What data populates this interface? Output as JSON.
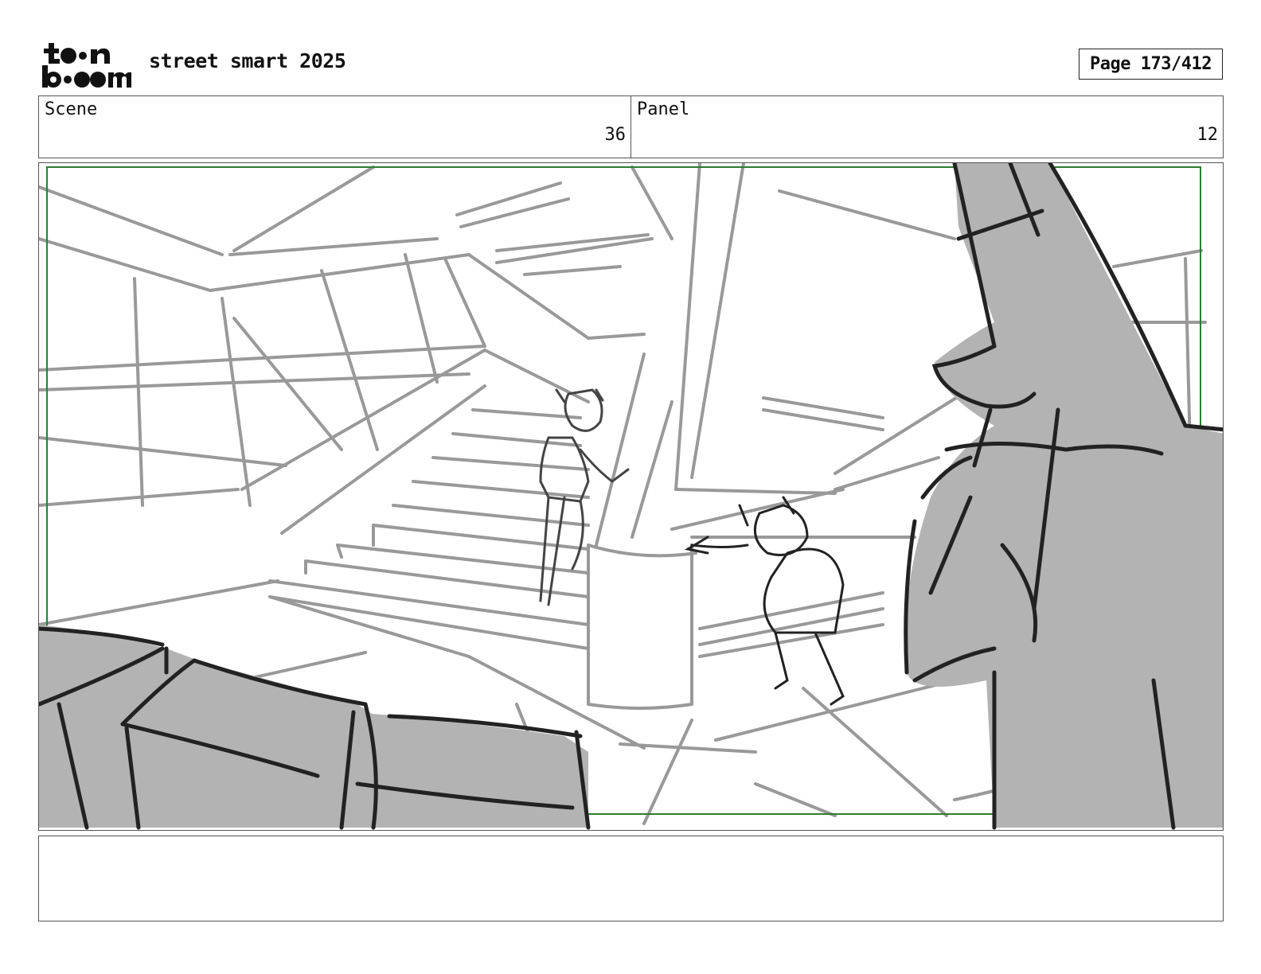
{
  "header": {
    "logo_line1": "toon",
    "logo_line2": "boom",
    "title": "street smart 2025",
    "page_indicator": "Page 173/412"
  },
  "info": {
    "scene_label": "Scene",
    "scene_value": "36",
    "panel_label": "Panel",
    "panel_value": "12"
  },
  "colors": {
    "safe_area_border": "#2e7d32",
    "sketch_grey": "#999999",
    "fill_grey": "#b3b3b3",
    "ink": "#222222"
  },
  "notes": ""
}
